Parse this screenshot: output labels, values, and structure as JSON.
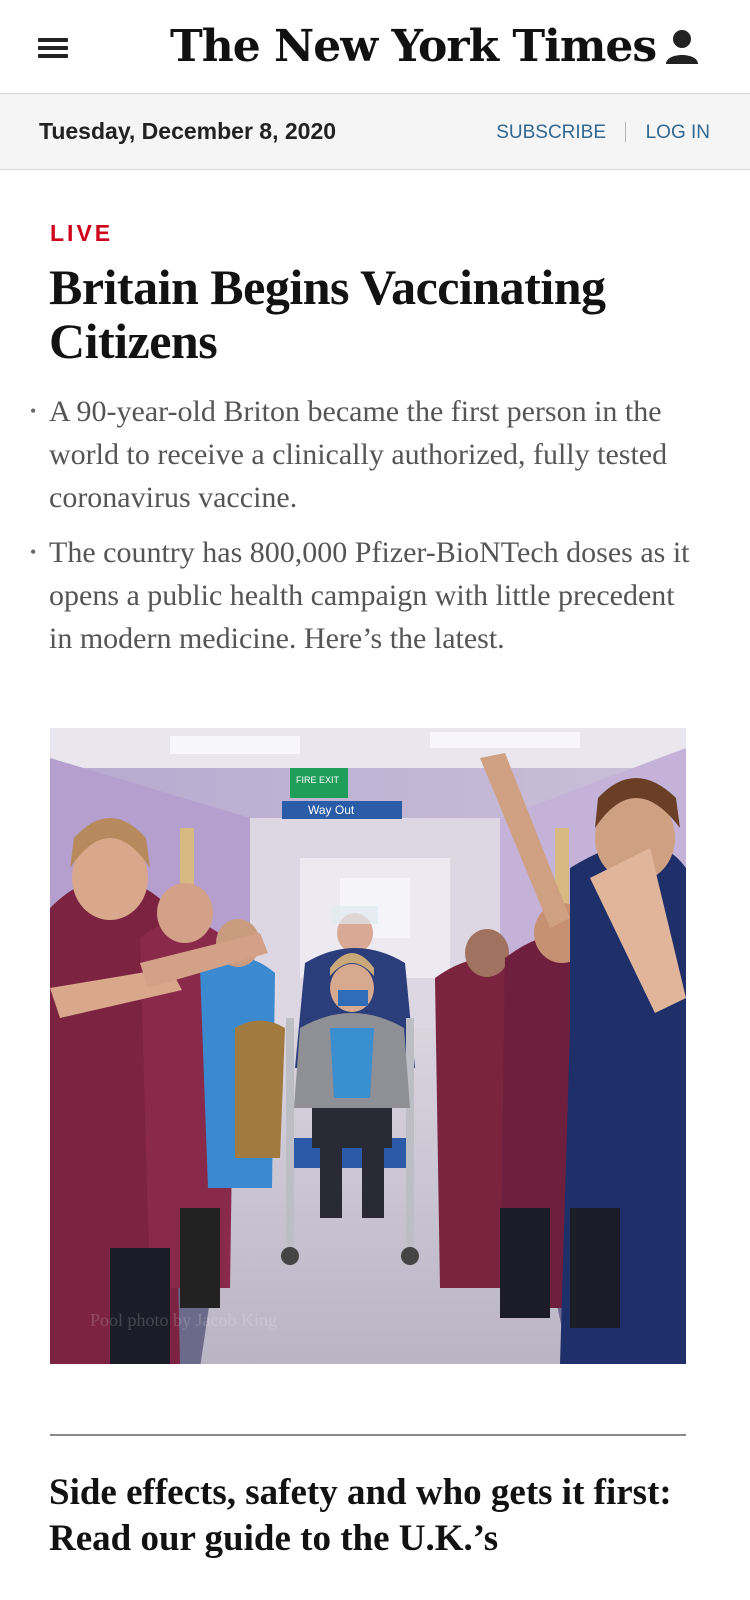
{
  "masthead": {
    "logo_text": "The New York Times",
    "menu_icon": "hamburger-menu-icon",
    "account_icon": "user-account-icon"
  },
  "datebar": {
    "date": "Tuesday, December 8, 2020",
    "subscribe_label": "SUBSCRIBE",
    "login_label": "LOG IN"
  },
  "article": {
    "label": "LIVE",
    "headline": "Britain Begins Vaccinating Citizens",
    "summary": [
      "A 90-year-old Briton became the first person in the world to receive a clinically authorized, fully tested coronavirus vaccine.",
      "The country has 800,000 Pfizer-BioNTech doses as it opens a public health campaign with little precedent in modern medicine. Here’s the latest."
    ],
    "image": {
      "sign_top": "FIRE EXIT",
      "sign_way": "Way Out",
      "caption_overlay": "Pool photo by Jacob King"
    }
  },
  "next_story": {
    "headline": "Side effects, safety and who gets it first: Read our guide to the U.K.’s"
  },
  "colors": {
    "live_red": "#d0021b",
    "link_blue": "#326891",
    "datebar_bg": "#f5f5f5"
  }
}
